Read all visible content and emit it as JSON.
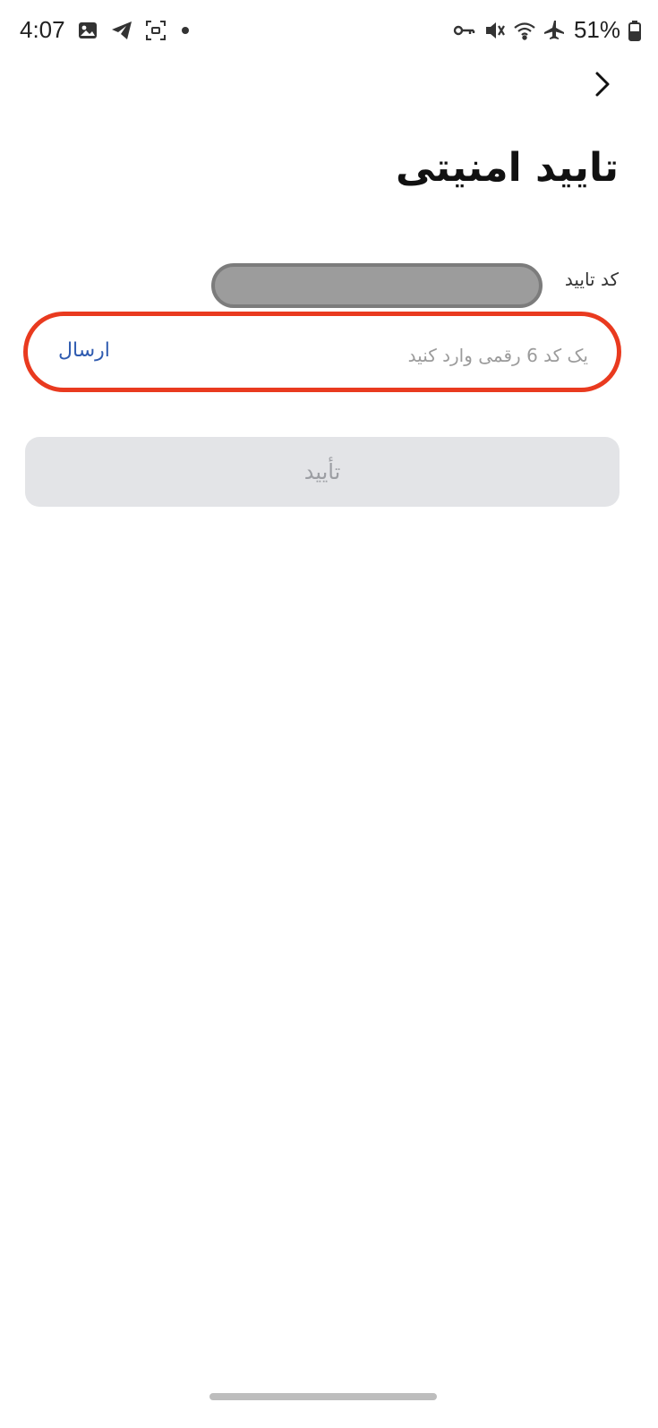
{
  "status_bar": {
    "time": "4:07",
    "battery_percent": "51%",
    "left_icons": [
      "gallery-icon",
      "telegram-icon",
      "screenshot-icon"
    ],
    "right_icons": [
      "vpn-key-icon",
      "mute-icon",
      "wifi-icon",
      "airplane-icon",
      "battery-icon"
    ]
  },
  "header": {
    "title": "تایید امنیتی",
    "back_icon": "chevron-right-icon"
  },
  "verification": {
    "label": "کد تایید",
    "placeholder": "یک کد 6 رقمی وارد کنید",
    "value": "",
    "send_label": "ارسال"
  },
  "confirm_button": {
    "label": "تأیید",
    "enabled": false
  },
  "colors": {
    "highlight_border": "#e93a1f",
    "link": "#2f5bb0",
    "button_disabled_bg": "#e3e4e7",
    "button_disabled_text": "#9c9ea3"
  }
}
